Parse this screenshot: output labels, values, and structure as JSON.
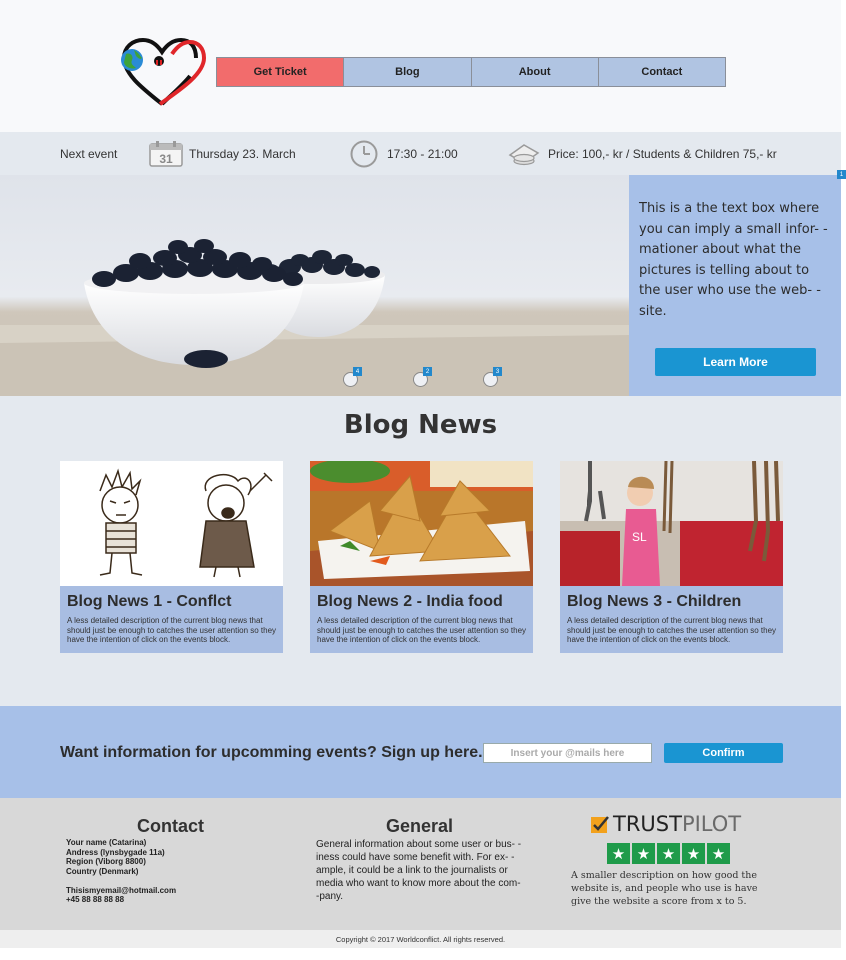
{
  "nav": {
    "items": [
      {
        "label": "Get Ticket"
      },
      {
        "label": "Blog"
      },
      {
        "label": "About"
      },
      {
        "label": "Contact"
      }
    ]
  },
  "event": {
    "label": "Next event",
    "date": "Thursday 23. March",
    "calendar_day": "31",
    "time": "17:30 - 21:00",
    "price": "Price: 100,- kr / Students & Children 75,- kr"
  },
  "hero": {
    "text": "This is a the text box where you can imply a small infor- -mationer about what the pictures is telling about to the user who use the web- -site.",
    "button": "Learn More",
    "dots": [
      "4",
      "2",
      "3"
    ],
    "corner_badge": "1"
  },
  "blog": {
    "title": "Blog News",
    "cards": [
      {
        "title": "Blog News 1 - Conflct",
        "desc": "A less detailed description of the current blog news that should just be enough to catches the user attention so they have the intention of click on the events block."
      },
      {
        "title": "Blog News 2 - India food",
        "desc": "A less detailed description of the current blog news that should just be enough to catches the user attention so they have the intention of click on the events block."
      },
      {
        "title": "Blog News 3 - Children",
        "desc": "A less detailed description of the current blog news that should just be enough to catches the user attention so they have the intention of click on the events block."
      }
    ]
  },
  "signup": {
    "text": "Want information for upcomming events? Sign up here.",
    "placeholder": "Insert your @mails here",
    "button": "Confirm"
  },
  "footer": {
    "contact": {
      "title": "Contact",
      "lines": [
        "Your name (Catarina)",
        "Andress (lynsbygade 11a)",
        "Region (Viborg 8800)",
        "Country (Denmark)",
        "",
        "Thisismyemail@hotmail.com",
        "+45 88 88 88 88"
      ]
    },
    "general": {
      "title": "General",
      "text": "General information about some user or bus- -iness could have some benefit with. For ex- -ample, it could be a link to the journalists or media who want to know more about the com- -pany."
    },
    "trustpilot": {
      "brand_part1": "TRUST",
      "brand_part2": "PILOT",
      "desc": "A smaller description on how good the website is, and people who use is have give the website a score from x to 5.",
      "stars": 5
    },
    "copyright": "Copyright © 2017 Worldconflict.  All rights reserved."
  },
  "colors": {
    "accent_blue": "#1a95d2",
    "panel_blue": "#a7c0e8",
    "ticket_red": "#f26c6c",
    "trustpilot_green": "#1f9b4a"
  }
}
